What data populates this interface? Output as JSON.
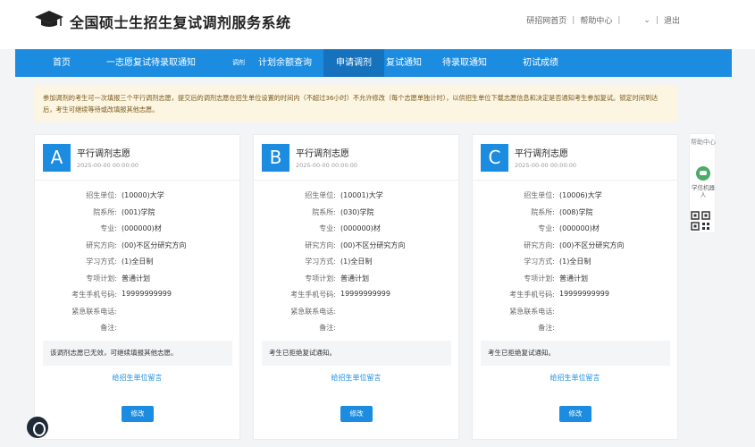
{
  "header": {
    "title": "全国硕士生招生复试调剂服务系统",
    "links": [
      "研招网首页",
      "帮助中心",
      "退出"
    ],
    "user_dropdown_icon": "chevron-down-icon"
  },
  "nav": {
    "items": [
      {
        "label": "首页"
      },
      {
        "label": "一志愿复试待录取通知"
      },
      {
        "label": "调剂"
      },
      {
        "label": "计划余额查询"
      },
      {
        "label": "申请调剂"
      },
      {
        "label": "复试通知"
      },
      {
        "label": "待录取通知"
      },
      {
        "label": "初试成绩"
      }
    ],
    "active": "申请调剂"
  },
  "notice": "参加调剂的考生可一次填报三个平行调剂志愿，提交后的调剂志愿在招生单位设置的时间内（不超过36小时）不允许修改（每个志愿单独计时），以供招生单位下载志愿信息和决定是否通知考生参加复试。锁定时间到达后，考生可继续等待或改填报其他志愿。",
  "labels": {
    "unit": "招生单位:",
    "department": "院系所:",
    "major": "专业:",
    "direction": "研究方向:",
    "study_mode": "学习方式:",
    "plan": "专项计划:",
    "phone": "考生手机号码:",
    "emergency": "紧急联系电话:",
    "remark": "备注:"
  },
  "cards": [
    {
      "letter": "A",
      "title": "平行调剂志愿",
      "date": "2025-00-00 00:00:00",
      "unit": "(10000)大学",
      "department": "(001)学院",
      "major": "(000000)材",
      "direction": "(00)不区分研究方向",
      "study_mode": "(1)全日制",
      "plan": "普通计划",
      "phone": "19999999999",
      "emergency": "",
      "remark": "",
      "status": "该调剂志愿已无效，可继续填报其他志愿。",
      "message_link": "给招生单位留言",
      "edit_label": "修改"
    },
    {
      "letter": "B",
      "title": "平行调剂志愿",
      "date": "2025-00-00 00:00:00",
      "unit": "(10001)大学",
      "department": "(030)学院",
      "major": "(000000)材",
      "direction": "(00)不区分研究方向",
      "study_mode": "(1)全日制",
      "plan": "普通计划",
      "phone": "19999999999",
      "emergency": "",
      "remark": "",
      "status": "考生已拒绝复试通知。",
      "message_link": "给招生单位留言",
      "edit_label": "修改"
    },
    {
      "letter": "C",
      "title": "平行调剂志愿",
      "date": "2025-00-00 00:00:00",
      "unit": "(10006)大学",
      "department": "(008)学院",
      "major": "(000000)材",
      "direction": "(00)不区分研究方向",
      "study_mode": "(1)全日制",
      "plan": "普通计划",
      "phone": "19999999999",
      "emergency": "",
      "remark": "",
      "status": "考生已拒绝复试通知。",
      "message_link": "给招生单位留言",
      "edit_label": "修改"
    }
  ],
  "side": {
    "help": "帮助中心",
    "robot": "学信机器人",
    "qr_icon": "qr-code-icon"
  },
  "colors": {
    "primary": "#1b8ce0",
    "nav_active": "#1772bd",
    "notice_bg": "#fbf5e2",
    "notice_text": "#7a5a1c"
  }
}
